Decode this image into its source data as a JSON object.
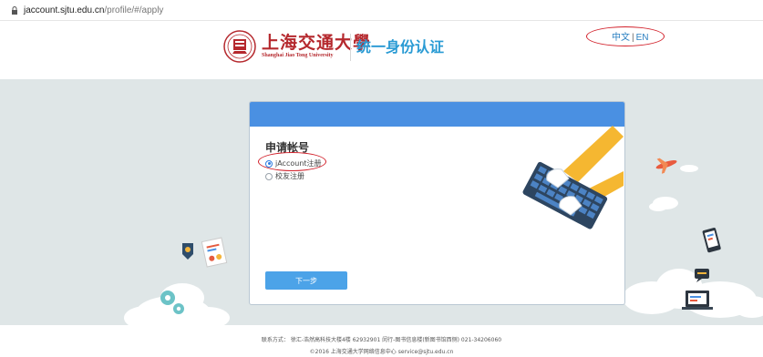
{
  "browser": {
    "url_host": "jaccount.sjtu.edu.cn",
    "url_path": "/profile/#/apply"
  },
  "header": {
    "university_cn": "上海交通大學",
    "university_en": "Shanghai Jiao Tong University",
    "system_title": "统一身份认证",
    "lang_cn": "中文",
    "lang_sep": "|",
    "lang_en": "EN"
  },
  "form": {
    "title": "申请帐号",
    "options": [
      {
        "label": "jAccount注册",
        "selected": true
      },
      {
        "label": "校友注册",
        "selected": false
      }
    ],
    "next_button": "下一步"
  },
  "footer": {
    "contact": "联系方式： 徐汇-浩然高科技大楼4楼 62932901 闵行-图书信息楼(新图书馆西侧) 021-34206060",
    "copyright": "©2016 上海交通大学网络信息中心 service@sjtu.edu.cn"
  },
  "colors": {
    "brand_red": "#b5292e",
    "title_blue": "#2a9bd4",
    "card_header": "#4a90e2",
    "button": "#4ca3e8",
    "annotation_red": "#d2202a",
    "background": "#dfe6e7"
  }
}
